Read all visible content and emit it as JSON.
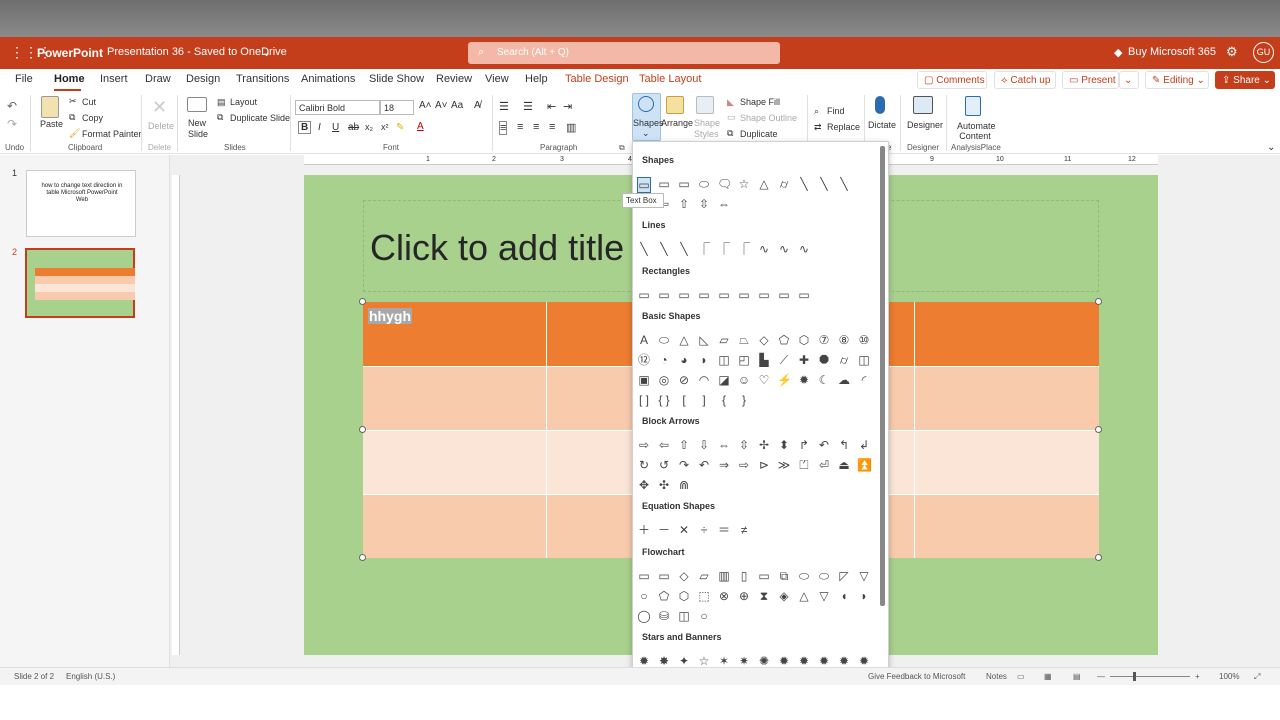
{
  "app": {
    "name": "PowerPoint",
    "doc_title": "Presentation 36 - Saved to OneDrive",
    "search_placeholder": "Search (Alt + Q)",
    "buy_label": "Buy Microsoft 365",
    "avatar_initials": "GU",
    "accent": "#c43e1c"
  },
  "tabs": [
    "File",
    "Home",
    "Insert",
    "Draw",
    "Design",
    "Transitions",
    "Animations",
    "Slide Show",
    "Review",
    "View",
    "Help",
    "Table Design",
    "Table Layout"
  ],
  "active_tab": "Home",
  "right_buttons": {
    "comments": "Comments",
    "catchup": "Catch up",
    "present": "Present",
    "editing": "Editing",
    "share": "Share"
  },
  "ribbon": {
    "undo_group": "Undo",
    "paste": "Paste",
    "cut": "Cut",
    "copy": "Copy",
    "format_painter": "Format Painter",
    "clipboard_group": "Clipboard",
    "delete": "Delete",
    "delete_group": "Delete",
    "new_slide": "New Slide",
    "layout": "Layout",
    "duplicate_slide": "Duplicate Slide",
    "slides_group": "Slides",
    "font_name": "Calibri Bold",
    "font_size": "18",
    "font_group": "Font",
    "paragraph_group": "Paragraph",
    "shapes": "Shapes",
    "arrange": "Arrange",
    "shape_styles": "Shape Styles",
    "shape_fill": "Shape Fill",
    "shape_outline": "Shape Outline",
    "duplicate": "Duplicate",
    "find": "Find",
    "replace": "Replace",
    "dictate": "Dictate",
    "voice_group_fragment": "e",
    "designer": "Designer",
    "designer_group": "Designer",
    "automate": "Automate Content",
    "analysisplace_group": "AnalysisPlace"
  },
  "thumbnails": [
    {
      "num": "1",
      "text": "how to change text direction in table Microsoft PowerPoint Web"
    },
    {
      "num": "2",
      "text": ""
    }
  ],
  "slide": {
    "title_placeholder": "Click to add title",
    "cell_text": "hhygh",
    "bg": "#a9d18e",
    "header_color": "#ed7d31",
    "row_dark": "#f8cbad",
    "row_light": "#fbe5d6"
  },
  "ruler_numbers": [
    "1",
    "2",
    "3",
    "4",
    "5",
    "6",
    "7",
    "8",
    "9",
    "10",
    "11",
    "12"
  ],
  "shapes_menu": {
    "tooltip": "Text Box",
    "sections": [
      {
        "title": "Shapes",
        "rows": [
          [
            "▭",
            "▭",
            "▭",
            "⬭",
            "🗨",
            "☆",
            "△",
            "⌭",
            "╲",
            "╲",
            "╲"
          ],
          [
            "⇨",
            "⇦",
            "⇧",
            "⇳",
            "⇔"
          ]
        ]
      },
      {
        "title": "Lines",
        "rows": [
          [
            "╲",
            "╲",
            "╲",
            "⎾",
            "⎾",
            "⎾",
            "∿",
            "∿",
            "∿"
          ]
        ]
      },
      {
        "title": "Rectangles",
        "rows": [
          [
            "▭",
            "▭",
            "▭",
            "▭",
            "▭",
            "▭",
            "▭",
            "▭",
            "▭"
          ]
        ]
      },
      {
        "title": "Basic Shapes",
        "rows": [
          [
            "A",
            "⬭",
            "△",
            "◺",
            "▱",
            "⏢",
            "◇",
            "⬠",
            "⬡",
            "⑦",
            "⑧",
            "⑩"
          ],
          [
            "⑫",
            "◔",
            "◕",
            "◗",
            "◫",
            "◰",
            "▙",
            "⟋",
            "✚",
            "⯃",
            "⌭",
            "◫"
          ],
          [
            "▣",
            "◎",
            "⊘",
            "◠",
            "◪",
            "☺",
            "♡",
            "⚡",
            "✹",
            "☾",
            "☁",
            "◜"
          ],
          [
            "[ ]",
            "{ }",
            "[",
            "]",
            "{",
            "}"
          ]
        ]
      },
      {
        "title": "Block Arrows",
        "rows": [
          [
            "⇨",
            "⇦",
            "⇧",
            "⇩",
            "⇔",
            "⇳",
            "✢",
            "⬍",
            "↱",
            "↶",
            "↰",
            "↲"
          ],
          [
            "↻",
            "↺",
            "↷",
            "↶",
            "⇒",
            "⇨",
            "⊳",
            "≫",
            "⏍",
            "⏎",
            "⏏",
            "⏫"
          ],
          [
            "✥",
            "✣",
            "⋒"
          ]
        ]
      },
      {
        "title": "Equation Shapes",
        "rows": [
          [
            "＋",
            "－",
            "✕",
            "÷",
            "＝",
            "≠"
          ]
        ]
      },
      {
        "title": "Flowchart",
        "rows": [
          [
            "▭",
            "▭",
            "◇",
            "▱",
            "▥",
            "▯",
            "▭",
            "⧉",
            "⬭",
            "⬭",
            "◸",
            "▽"
          ],
          [
            "○",
            "⬠",
            "⬡",
            "⬚",
            "⊗",
            "⊕",
            "⧗",
            "◈",
            "△",
            "▽",
            "◖",
            "◗"
          ],
          [
            "◯",
            "⛁",
            "◫",
            "○"
          ]
        ]
      },
      {
        "title": "Stars and Banners",
        "rows": [
          [
            "✹",
            "✸",
            "✦",
            "☆",
            "✶",
            "✷",
            "✺",
            "✹",
            "✹",
            "✹",
            "✹",
            "✹"
          ],
          [
            "⎍",
            "⎍",
            "⎍",
            "⎍",
            "⎍",
            "⎍",
            "⎍",
            "⎍"
          ]
        ]
      }
    ]
  },
  "status": {
    "slide": "Slide 2 of 2",
    "language": "English (U.S.)",
    "feedback": "Give Feedback to Microsoft",
    "notes": "Notes",
    "zoom": "100%"
  }
}
